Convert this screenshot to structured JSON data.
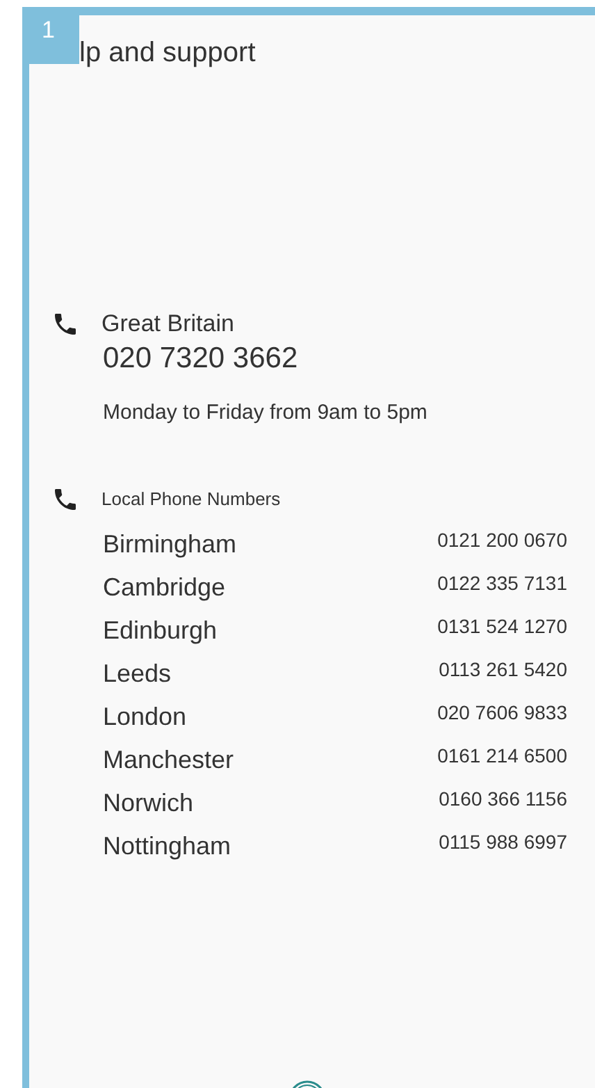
{
  "badge": "1",
  "title": "lp and support",
  "main_contact": {
    "label": "Great Britain",
    "phone": "020 7320 3662",
    "hours": "Monday to Friday from 9am to 5pm"
  },
  "local": {
    "heading": "Local Phone Numbers",
    "numbers": [
      {
        "city": "Birmingham",
        "phone": "0121 200 0670"
      },
      {
        "city": "Cambridge",
        "phone": "0122 335 7131"
      },
      {
        "city": "Edinburgh",
        "phone": "0131 524 1270"
      },
      {
        "city": "Leeds",
        "phone": "0113 261 5420"
      },
      {
        "city": "London",
        "phone": "020 7606 9833"
      },
      {
        "city": "Manchester",
        "phone": "0161 214 6500"
      },
      {
        "city": "Norwich",
        "phone": "0160 366 1156"
      },
      {
        "city": "Nottingham",
        "phone": "0115 988 6997"
      }
    ]
  }
}
